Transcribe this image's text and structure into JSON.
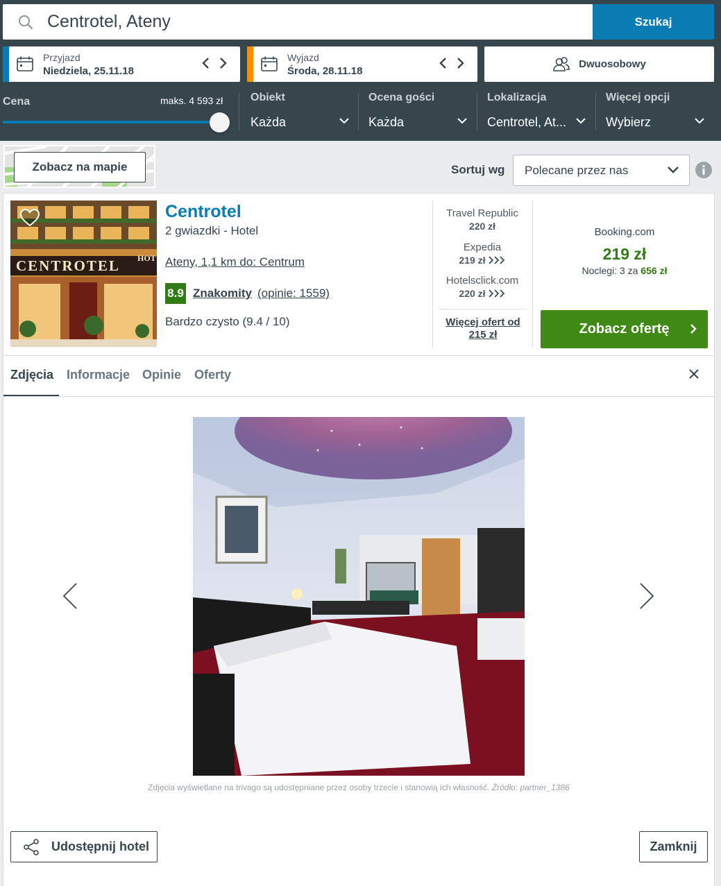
{
  "search": {
    "query": "Centrotel, Ateny",
    "button_label": "Szukaj"
  },
  "checkin": {
    "label": "Przyjazd",
    "value": "Niedziela, 25.11.18",
    "accent": "#0a7cb4"
  },
  "checkout": {
    "label": "Wyjazd",
    "value": "Środa, 28.11.18",
    "accent": "#f48f00"
  },
  "room": {
    "label": "Dwuosobowy"
  },
  "filters": {
    "price_label": "Cena",
    "price_max": "maks. 4 593 zł",
    "price_fraction": 1.0,
    "items": [
      {
        "title": "Obiekt",
        "value": "Każda"
      },
      {
        "title": "Ocena gości",
        "value": "Każda"
      },
      {
        "title": "Lokalizacja",
        "value": "Centrotel, At..."
      },
      {
        "title": "Więcej opcji",
        "value": "Wybierz"
      }
    ]
  },
  "map": {
    "button_label": "Zobacz na mapie"
  },
  "sort": {
    "label": "Sortuj wg",
    "value": "Polecane przez nas"
  },
  "hotel": {
    "name": "Centrotel",
    "type": "2 gwiazdki -  Hotel",
    "location": "Ateny, 1,1 km do: Centrum",
    "rating": "8.9",
    "rating_word": "Znakomity",
    "rating_count": "(opinie: 1559)",
    "clean": "Bardzo czysto (9.4 / 10)",
    "sign_text": "CENTROTEL",
    "sign_text_2": "HOT",
    "offers": [
      {
        "provider": "Travel Republic",
        "price": "220 zł"
      },
      {
        "provider": "Expedia",
        "price": "219 zł"
      },
      {
        "provider": "Hotelsclick.com",
        "price": "220 zł"
      }
    ],
    "more_offers": "Więcej ofert od 215 zł",
    "main_provider": "Booking.com",
    "main_price": "219 zł",
    "nights_prefix": "Noclegi: 3 za",
    "nights_total": "656 zł",
    "deal_button": "Zobacz ofertę"
  },
  "tabs": [
    {
      "label": "Zdjęcia"
    },
    {
      "label": "Informacje"
    },
    {
      "label": "Opinie"
    },
    {
      "label": "Oferty"
    }
  ],
  "gallery": {
    "credit_text": "Zdjęcia wyświetlane na trivago są udostępniane przez osoby trzecie i stanowią ich własność.",
    "credit_source": "Źródło: partner_1386"
  },
  "footer": {
    "share_label": "Udostępnij hotel",
    "close_label": "Zamknij"
  }
}
